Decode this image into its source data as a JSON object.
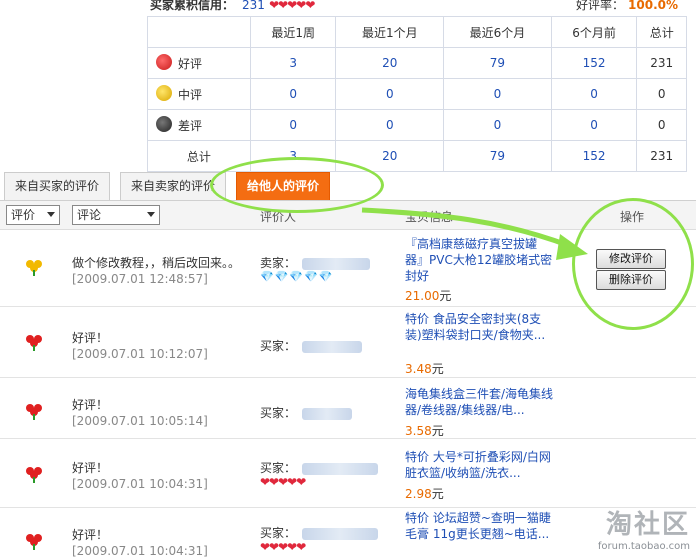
{
  "header": {
    "credit_label": "买家累积信用：",
    "credit_value": "231",
    "good_rate_label": "好评率：",
    "good_rate_value": "100.0%"
  },
  "stats": {
    "columns": [
      "",
      "最近1周",
      "最近1个月",
      "最近6个月",
      "6个月前",
      "总计"
    ],
    "rows": [
      {
        "label": "好评",
        "values": [
          "3",
          "20",
          "79",
          "152",
          "231"
        ],
        "icon": "red-flower-icon"
      },
      {
        "label": "中评",
        "values": [
          "0",
          "0",
          "0",
          "0",
          "0"
        ],
        "icon": "yellow-flower-icon"
      },
      {
        "label": "差评",
        "values": [
          "0",
          "0",
          "0",
          "0",
          "0"
        ],
        "icon": "black-flower-icon"
      },
      {
        "label": "总计",
        "values": [
          "3",
          "20",
          "79",
          "152",
          "231"
        ]
      }
    ]
  },
  "tabs": [
    "来自买家的评价",
    "来自卖家的评价",
    "给他人的评价"
  ],
  "filters": {
    "rating_select": "评价",
    "comment_select": "评论"
  },
  "list_headers": {
    "reviewer": "评价人",
    "item_info": "宝贝信息",
    "action": "操作"
  },
  "reviews": [
    {
      "flower": "yellow",
      "comment": "做个修改教程，，稍后改回来。。",
      "date": "[2009.07.01 12:48:57]",
      "role": "卖家：",
      "badge": "💎💎💎💎💎",
      "item": "『高档康慈磁疗真空拔罐器』PVC大枪12罐胶堵式密封好",
      "price": "21.00",
      "currency": "元",
      "buttons": [
        "修改评价",
        "删除评价"
      ]
    },
    {
      "flower": "red",
      "comment": "好评！",
      "date": "[2009.07.01 10:12:07]",
      "role": "买家：",
      "badge": "",
      "item": "特价 食品安全密封夹(8支装)塑料袋封口夹/食物夹...",
      "price": "3.48",
      "currency": "元"
    },
    {
      "flower": "red",
      "comment": "好评！",
      "date": "[2009.07.01 10:05:14]",
      "role": "买家：",
      "badge": "",
      "item": "海龟集线盒三件套/海龟集线器/卷线器/集线器/电...",
      "price": "3.58",
      "currency": "元"
    },
    {
      "flower": "red",
      "comment": "好评！",
      "date": "[2009.07.01 10:04:31]",
      "role": "买家：",
      "badge": "❤❤❤❤❤",
      "item": "特价 大号*可折叠彩网/白网 脏衣篮/收纳篮/洗衣...",
      "price": "2.98",
      "currency": "元"
    },
    {
      "flower": "red",
      "comment": "好评！",
      "date": "[2009.07.01 10:04:31]",
      "role": "买家：",
      "badge": "❤❤❤❤❤",
      "item": "特价 论坛超赞~查明一猫睫毛膏 11g更长更翘~电话...",
      "price": "",
      "currency": ""
    }
  ],
  "watermark": {
    "big": "淘社区",
    "small": "forum.taobao.com"
  },
  "colors": {
    "accent_tab": "#f46d12",
    "link_blue": "#1f4fb5",
    "price_orange": "#e86a00",
    "annotation_green": "#8fe04a"
  }
}
